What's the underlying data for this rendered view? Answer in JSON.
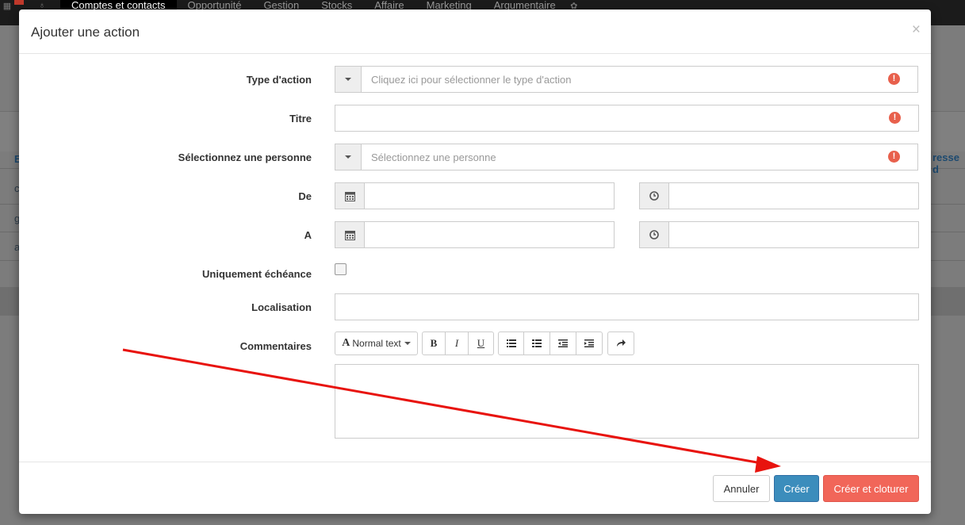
{
  "background": {
    "nav": [
      "Comptes et contacts",
      "Opportunité",
      "Gestion",
      "Stocks",
      "Affaire",
      "Marketing",
      "Argumentaire"
    ],
    "active_nav_index": 0,
    "column_header_right": "resse d",
    "column_header_left": "E",
    "row_initials": [
      "c",
      "g",
      "a"
    ]
  },
  "modal": {
    "title": "Ajouter une action",
    "close_label": "×",
    "fields": {
      "type_action": {
        "label": "Type d'action",
        "placeholder": "Cliquez ici pour sélectionner le type d'action"
      },
      "titre": {
        "label": "Titre",
        "value": ""
      },
      "personne": {
        "label": "Sélectionnez une personne",
        "placeholder": "Sélectionnez une personne"
      },
      "de": {
        "label": "De",
        "date": "",
        "time": ""
      },
      "a": {
        "label": "A",
        "date": "",
        "time": ""
      },
      "echeance": {
        "label": "Uniquement échéance",
        "checked": false
      },
      "localisation": {
        "label": "Localisation",
        "value": ""
      },
      "commentaires": {
        "label": "Commentaires",
        "style_dropdown": "Normal text",
        "value": ""
      }
    },
    "warning_icon": "exclamation-circle-icon",
    "buttons": {
      "cancel": "Annuler",
      "create": "Créer",
      "create_close": "Créer et cloturer"
    }
  },
  "colors": {
    "primary": "#3c8dbc",
    "danger": "#f16659",
    "warning": "#e8604c",
    "annotation_arrow": "#e8130e"
  }
}
